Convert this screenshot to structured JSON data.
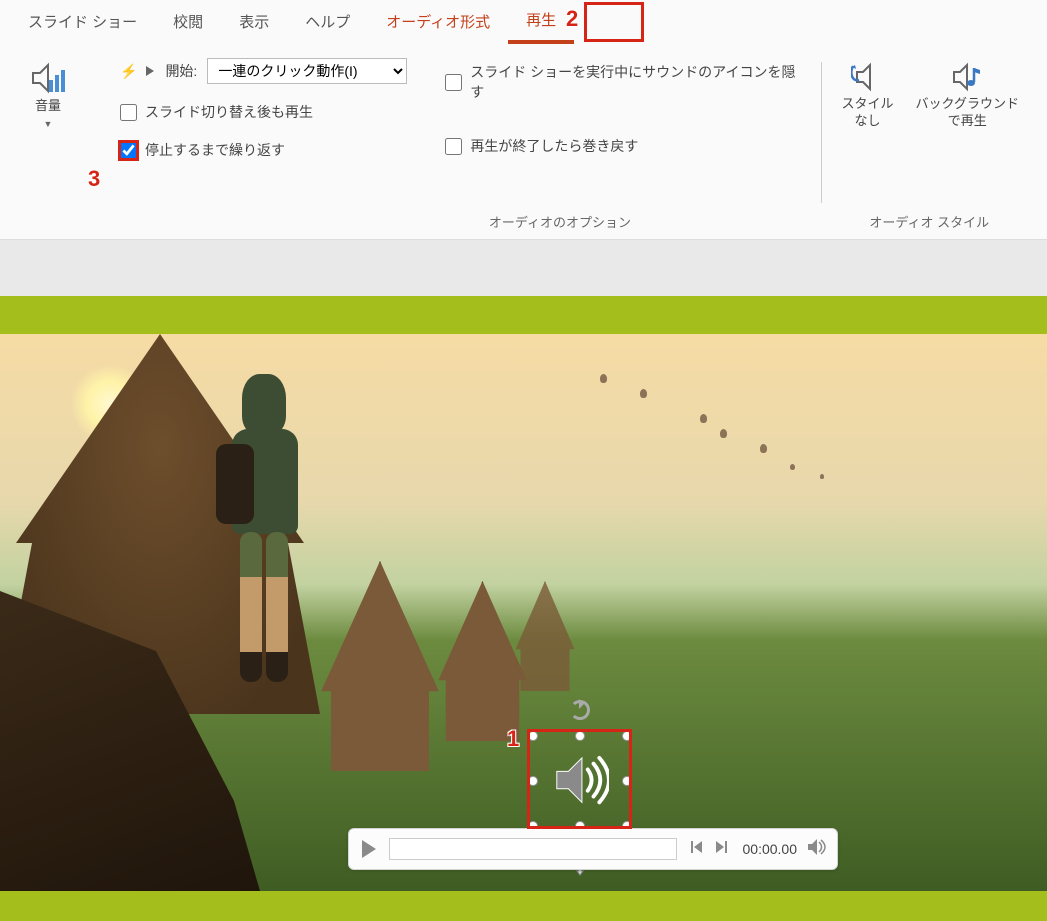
{
  "tabs": {
    "slideshow": "スライド ショー",
    "review": "校閲",
    "view": "表示",
    "help": "ヘルプ",
    "audio_format": "オーディオ形式",
    "playback": "再生"
  },
  "ribbon": {
    "volume_label": "音量",
    "start_label": "開始:",
    "start_value": "一連のクリック動作(I)",
    "play_across": "スライド切り替え後も再生",
    "loop_until": "停止するまで繰り返す",
    "hide_icon": "スライド ショーを実行中にサウンドのアイコンを隠す",
    "rewind": "再生が終了したら巻き戻す",
    "group_options": "オーディオのオプション",
    "no_style": "スタイル\nなし",
    "bg_play": "バックグラウンド\nで再生",
    "group_styles": "オーディオ スタイル"
  },
  "player": {
    "time": "00:00.00"
  },
  "annotations": {
    "n1": "1",
    "n2": "2",
    "n3": "3"
  }
}
